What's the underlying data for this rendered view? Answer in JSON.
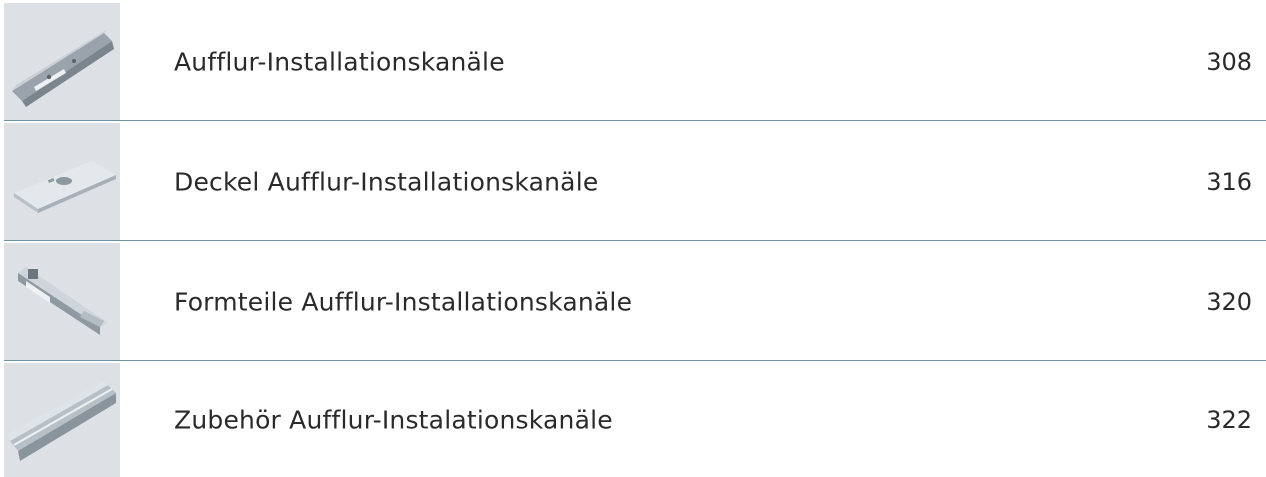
{
  "colors": {
    "divider": "#6f93a6",
    "thumbnail_background": "#dde1e6",
    "text": "#2a2a2a"
  },
  "items": [
    {
      "title": "Aufflur-Installationskanäle",
      "page": "308",
      "icon": "cable-duct-icon"
    },
    {
      "title": "Deckel Aufflur-Installationskanäle",
      "page": "316",
      "icon": "duct-cover-icon"
    },
    {
      "title": "Formteile Aufflur-Installationskanäle",
      "page": "320",
      "icon": "duct-fitting-icon"
    },
    {
      "title": "Zubehör Aufflur-Instalationskanäle",
      "page": "322",
      "icon": "duct-accessory-rail-icon"
    }
  ]
}
